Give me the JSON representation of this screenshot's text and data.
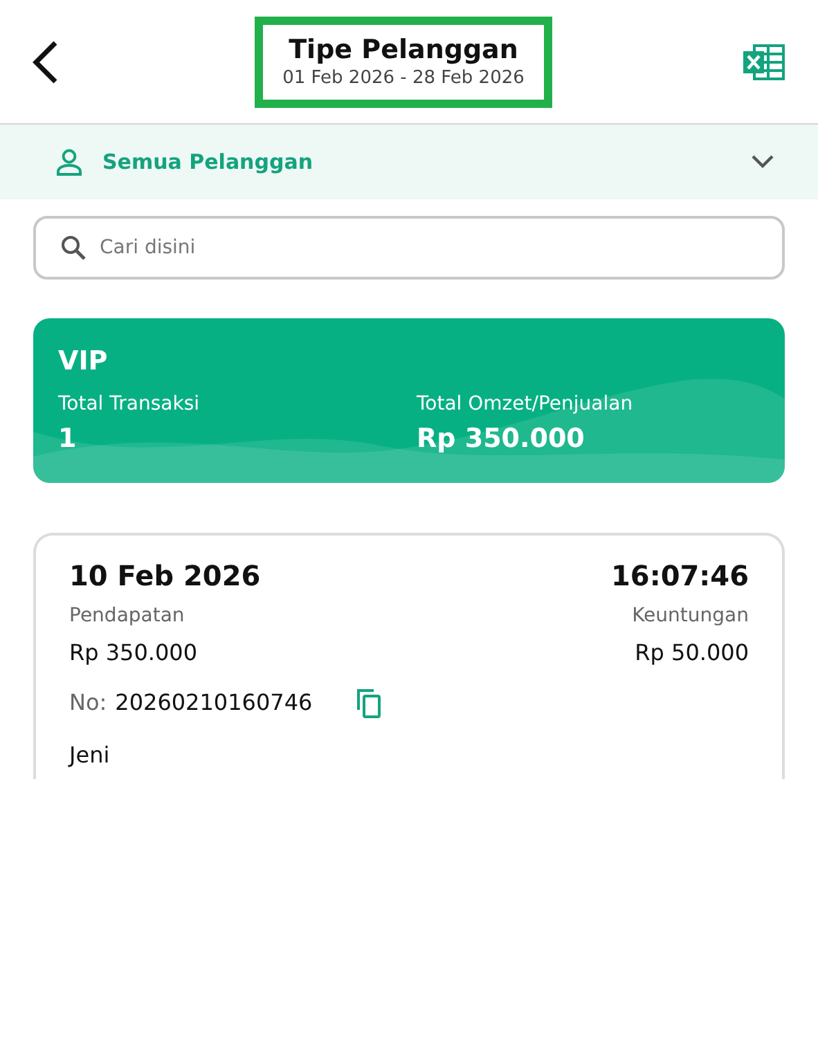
{
  "header": {
    "title": "Tipe Pelanggan",
    "date_range": "01 Feb 2026 - 28 Feb 2026",
    "highlighted": true
  },
  "filter": {
    "label": "Semua Pelanggan"
  },
  "search": {
    "placeholder": "Cari disini"
  },
  "summary": {
    "title": "VIP",
    "transactions_label": "Total Transaksi",
    "transactions_value": "1",
    "revenue_label": "Total Omzet/Penjualan",
    "revenue_value": "Rp 350.000"
  },
  "transactions": [
    {
      "date": "10 Feb 2026",
      "time": "16:07:46",
      "income_label": "Pendapatan",
      "income": "Rp 350.000",
      "profit_label": "Keuntungan",
      "profit": "Rp 50.000",
      "number_label": "No:",
      "number": "20260210160746",
      "customer": "Jeni"
    }
  ]
}
